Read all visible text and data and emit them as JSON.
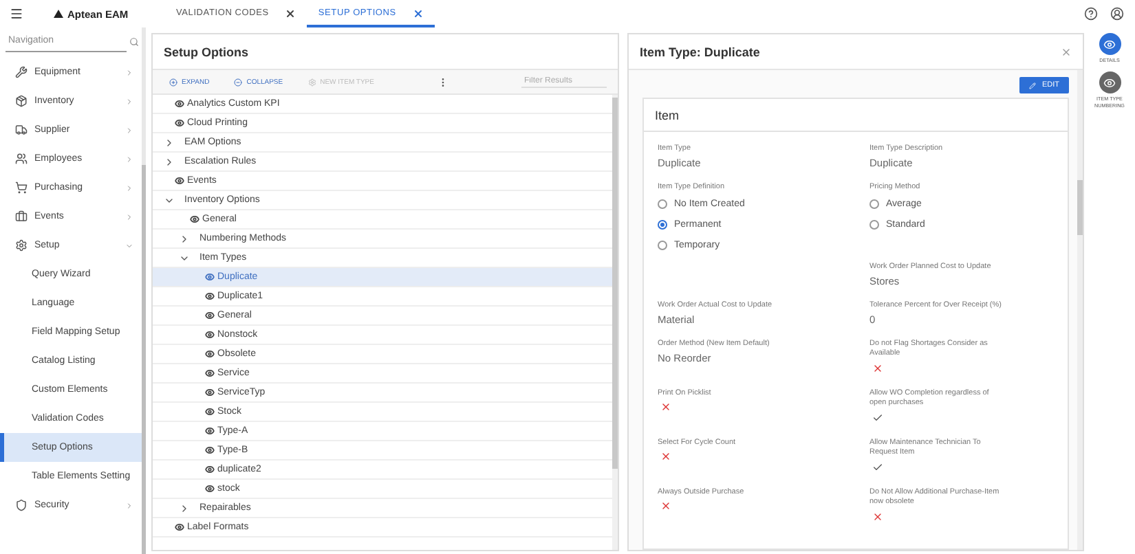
{
  "topbar": {
    "logo": "Aptean EAM"
  },
  "tabs": [
    {
      "label": "VALIDATION CODES",
      "selected": false
    },
    {
      "label": "SETUP OPTIONS",
      "selected": true
    }
  ],
  "navigation": {
    "placeholder": "Navigation",
    "items": [
      {
        "label": "Equipment",
        "expanded": false
      },
      {
        "label": "Inventory",
        "expanded": false
      },
      {
        "label": "Supplier",
        "expanded": false
      },
      {
        "label": "Employees",
        "expanded": false
      },
      {
        "label": "Purchasing",
        "expanded": false
      },
      {
        "label": "Events",
        "expanded": false
      },
      {
        "label": "Setup",
        "expanded": true,
        "children": [
          {
            "label": "Query Wizard",
            "selected": false
          },
          {
            "label": "Language",
            "selected": false
          },
          {
            "label": "Field Mapping Setup",
            "selected": false
          },
          {
            "label": "Catalog Listing",
            "selected": false
          },
          {
            "label": "Custom Elements",
            "selected": false
          },
          {
            "label": "Validation Codes",
            "selected": false
          },
          {
            "label": "Setup Options",
            "selected": true
          },
          {
            "label": "Table Elements Setting",
            "selected": false
          }
        ]
      },
      {
        "label": "Security",
        "expanded": false
      }
    ]
  },
  "setup_panel": {
    "title": "Setup Options",
    "filter_placeholder": "Filter Results",
    "toolbar": [
      {
        "label": "EXPAND",
        "disabled": false
      },
      {
        "label": "COLLAPSE",
        "disabled": false
      },
      {
        "label": "NEW ITEM TYPE",
        "disabled": true
      }
    ],
    "tree": [
      {
        "label": "Analytics Custom KPI",
        "kind": "view",
        "selected": false
      },
      {
        "label": "Cloud Printing",
        "kind": "view",
        "selected": false
      },
      {
        "label": "EAM Options",
        "kind": "group",
        "expanded": false,
        "selected": false
      },
      {
        "label": "Escalation Rules",
        "kind": "group",
        "expanded": false,
        "selected": false
      },
      {
        "label": "Events",
        "kind": "view",
        "selected": false
      },
      {
        "label": "Inventory Options",
        "kind": "group",
        "expanded": true,
        "selected": false,
        "children": [
          {
            "label": "General",
            "kind": "view",
            "selected": false
          },
          {
            "label": "Numbering Methods",
            "kind": "group",
            "expanded": false,
            "selected": false
          },
          {
            "label": "Item Types",
            "kind": "group",
            "expanded": true,
            "selected": false,
            "children": [
              {
                "label": "Duplicate",
                "kind": "view",
                "selected": true
              },
              {
                "label": "Duplicate1",
                "kind": "view",
                "selected": false
              },
              {
                "label": "General",
                "kind": "view",
                "selected": false
              },
              {
                "label": "Nonstock",
                "kind": "view",
                "selected": false
              },
              {
                "label": "Obsolete",
                "kind": "view",
                "selected": false
              },
              {
                "label": "Service",
                "kind": "view",
                "selected": false
              },
              {
                "label": "ServiceTyp",
                "kind": "view",
                "selected": false
              },
              {
                "label": "Stock",
                "kind": "view",
                "selected": false
              },
              {
                "label": "Type-A",
                "kind": "view",
                "selected": false
              },
              {
                "label": "Type-B",
                "kind": "view",
                "selected": false
              },
              {
                "label": "duplicate2",
                "kind": "view",
                "selected": false
              },
              {
                "label": "stock",
                "kind": "view",
                "selected": false
              }
            ]
          },
          {
            "label": "Repairables",
            "kind": "group",
            "expanded": false,
            "selected": false
          }
        ]
      },
      {
        "label": "Label Formats",
        "kind": "view",
        "selected": false
      }
    ]
  },
  "detail_panel": {
    "title": "Item Type: Duplicate",
    "edit_label": "EDIT",
    "card_title": "Item",
    "rows": [
      [
        {
          "kind": "text",
          "label": "Item Type",
          "value": "Duplicate"
        },
        {
          "kind": "text",
          "label": "Item Type Description",
          "value": "Duplicate"
        }
      ],
      [
        {
          "kind": "radio",
          "label": "Item Type Definition",
          "options": [
            {
              "label": "No Item Created",
              "selected": false
            },
            {
              "label": "Permanent",
              "selected": true
            },
            {
              "label": "Temporary",
              "selected": false
            }
          ]
        },
        {
          "kind": "radio",
          "label": "Pricing Method",
          "options": [
            {
              "label": "Average",
              "selected": false
            },
            {
              "label": "Standard",
              "selected": false
            }
          ]
        }
      ],
      [
        null,
        {
          "kind": "text",
          "label": "Work Order Planned Cost to Update",
          "value": "Stores"
        }
      ],
      [
        {
          "kind": "text",
          "label": "Work Order Actual Cost to Update",
          "value": "Material"
        },
        {
          "kind": "text",
          "label": "Tolerance Percent for Over Receipt (%)",
          "value": "0"
        }
      ],
      [
        {
          "kind": "text",
          "label": "Order Method (New Item Default)",
          "value": "No Reorder"
        },
        {
          "kind": "flag",
          "label": "Do not Flag Shortages Consider as Available",
          "checked": false
        }
      ],
      [
        {
          "kind": "flag",
          "label": "Print On Picklist",
          "checked": false
        },
        {
          "kind": "flag",
          "label": "Allow WO Completion regardless of open purchases",
          "checked": true
        }
      ],
      [
        {
          "kind": "flag",
          "label": "Select For Cycle Count",
          "checked": false
        },
        {
          "kind": "flag",
          "label": "Allow Maintenance Technician To Request Item",
          "checked": true
        }
      ],
      [
        {
          "kind": "flag",
          "label": "Always Outside Purchase",
          "checked": false
        },
        {
          "kind": "flag",
          "label": "Do Not Allow Additional Purchase-Item now obsolete",
          "checked": false
        }
      ]
    ]
  },
  "side_rail": [
    {
      "label": "DETAILS",
      "selected": true
    },
    {
      "label": "ITEM TYPE NUMBERING",
      "selected": false
    }
  ]
}
